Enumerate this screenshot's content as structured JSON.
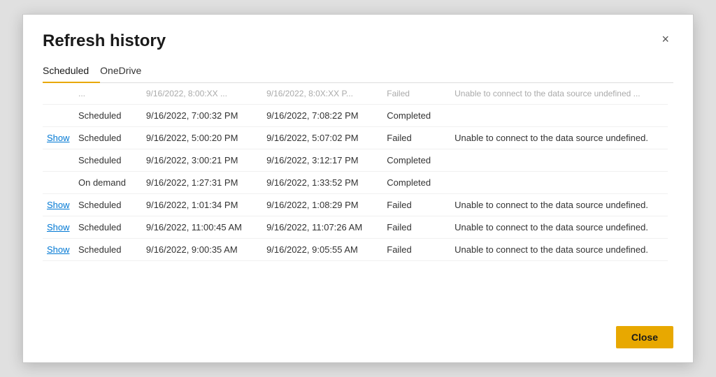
{
  "dialog": {
    "title": "Refresh history",
    "close_icon": "×"
  },
  "tabs": [
    {
      "label": "Scheduled",
      "active": true
    },
    {
      "label": "OneDrive",
      "active": false
    }
  ],
  "rows": [
    {
      "show": "",
      "type": "...",
      "start": "9/16/2022, 8:00:XX ...",
      "end": "9/16/2022, 8:0X:XX P...",
      "status": "Failed",
      "error": "Unable to connect to the data source undefined ...",
      "faded": true
    },
    {
      "show": "",
      "type": "Scheduled",
      "start": "9/16/2022, 7:00:32 PM",
      "end": "9/16/2022, 7:08:22 PM",
      "status": "Completed",
      "error": "",
      "faded": false
    },
    {
      "show": "Show",
      "type": "Scheduled",
      "start": "9/16/2022, 5:00:20 PM",
      "end": "9/16/2022, 5:07:02 PM",
      "status": "Failed",
      "error": "Unable to connect to the data source undefined.",
      "faded": false
    },
    {
      "show": "",
      "type": "Scheduled",
      "start": "9/16/2022, 3:00:21 PM",
      "end": "9/16/2022, 3:12:17 PM",
      "status": "Completed",
      "error": "",
      "faded": false
    },
    {
      "show": "",
      "type": "On demand",
      "start": "9/16/2022, 1:27:31 PM",
      "end": "9/16/2022, 1:33:52 PM",
      "status": "Completed",
      "error": "",
      "faded": false
    },
    {
      "show": "Show",
      "type": "Scheduled",
      "start": "9/16/2022, 1:01:34 PM",
      "end": "9/16/2022, 1:08:29 PM",
      "status": "Failed",
      "error": "Unable to connect to the data source undefined.",
      "faded": false
    },
    {
      "show": "Show",
      "type": "Scheduled",
      "start": "9/16/2022, 11:00:45 AM",
      "end": "9/16/2022, 11:07:26 AM",
      "status": "Failed",
      "error": "Unable to connect to the data source undefined.",
      "faded": false
    },
    {
      "show": "Show",
      "type": "Scheduled",
      "start": "9/16/2022, 9:00:35 AM",
      "end": "9/16/2022, 9:05:55 AM",
      "status": "Failed",
      "error": "Unable to connect to the data source undefined.",
      "faded": false
    }
  ],
  "footer": {
    "close_label": "Close"
  }
}
